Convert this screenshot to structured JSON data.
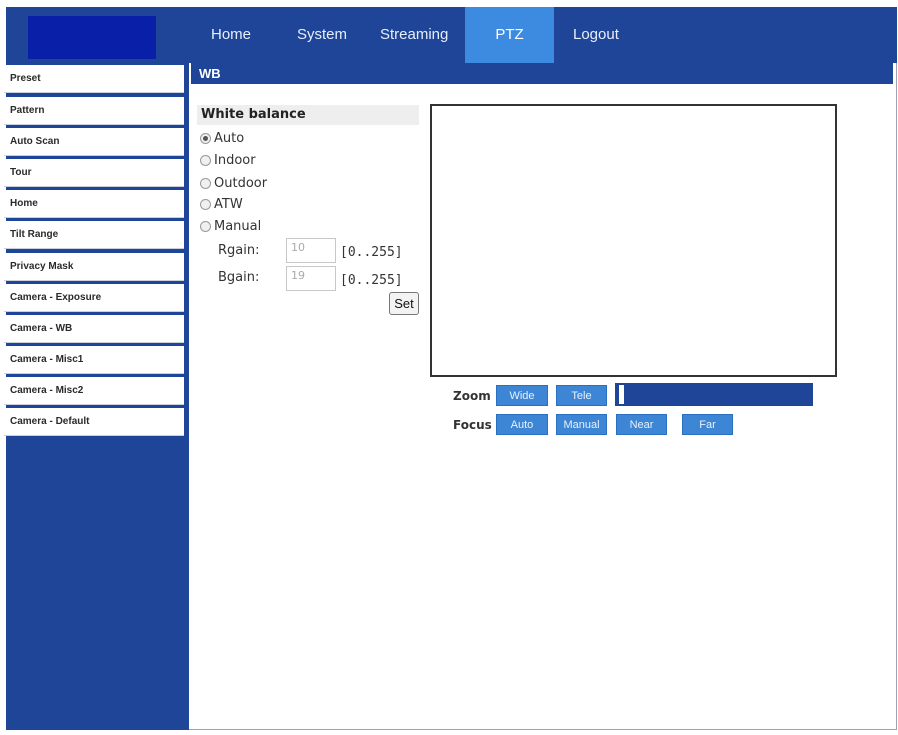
{
  "nav": {
    "items": [
      {
        "label": "Home"
      },
      {
        "label": "System"
      },
      {
        "label": "Streaming"
      },
      {
        "label": "PTZ",
        "active": true
      },
      {
        "label": "Logout"
      }
    ]
  },
  "sidebar": {
    "items": [
      {
        "label": "Preset"
      },
      {
        "label": "Pattern"
      },
      {
        "label": "Auto Scan"
      },
      {
        "label": "Tour"
      },
      {
        "label": "Home"
      },
      {
        "label": "Tilt Range"
      },
      {
        "label": "Privacy Mask"
      },
      {
        "label": "Camera - Exposure"
      },
      {
        "label": "Camera - WB"
      },
      {
        "label": "Camera - Misc1"
      },
      {
        "label": "Camera - Misc2"
      },
      {
        "label": "Camera - Default"
      }
    ]
  },
  "section": {
    "title": "WB"
  },
  "white_balance": {
    "title": "White balance",
    "options": [
      {
        "label": "Auto",
        "checked": true
      },
      {
        "label": "Indoor",
        "checked": false
      },
      {
        "label": "Outdoor",
        "checked": false
      },
      {
        "label": "ATW",
        "checked": false
      },
      {
        "label": "Manual",
        "checked": false
      }
    ],
    "rgain": {
      "label": "Rgain:",
      "value": "10",
      "range": "[0..255]"
    },
    "bgain": {
      "label": "Bgain:",
      "value": "19",
      "range": "[0..255]"
    },
    "set_label": "Set"
  },
  "controls": {
    "zoom": {
      "label": "Zoom",
      "wide": "Wide",
      "tele": "Tele"
    },
    "focus": {
      "label": "Focus",
      "auto": "Auto",
      "manual": "Manual",
      "near": "Near",
      "far": "Far"
    }
  },
  "colors": {
    "brand": "#1e4597",
    "accent": "#3d86d6"
  }
}
